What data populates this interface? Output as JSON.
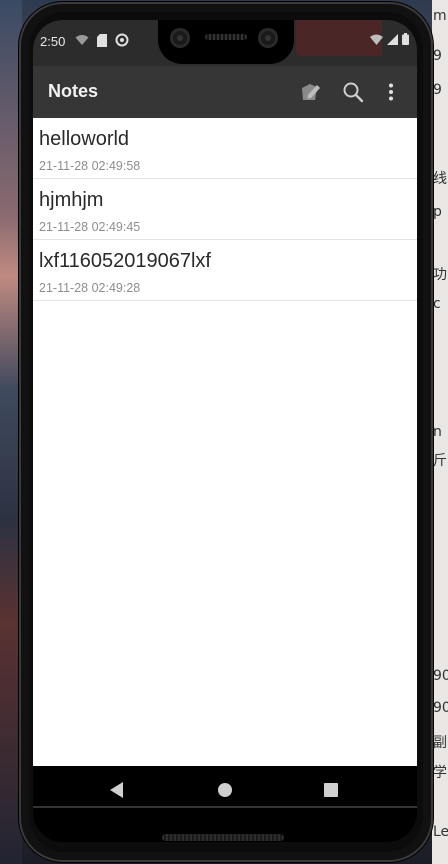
{
  "statusbar": {
    "time": "2:50"
  },
  "appbar": {
    "title": "Notes",
    "new_note_icon": "edit-note-icon",
    "search_icon": "search-icon",
    "more_icon": "more-vert-icon"
  },
  "notes": [
    {
      "title": "helloworld",
      "date": "21-11-28 02:49:58"
    },
    {
      "title": "hjmhjm",
      "date": "21-11-28 02:49:45"
    },
    {
      "title": "lxf116052019067lxf",
      "date": "21-11-28 02:49:28"
    }
  ],
  "navbar": {
    "back_icon": "back-triangle-icon",
    "home_icon": "home-circle-icon",
    "recents_icon": "recents-square-icon"
  },
  "colors": {
    "appbar": "#363636",
    "statusbar": "#2c2c2c",
    "content_bg": "#ffffff",
    "note_title": "#2a2a2a",
    "note_date": "#8e8e8e"
  }
}
